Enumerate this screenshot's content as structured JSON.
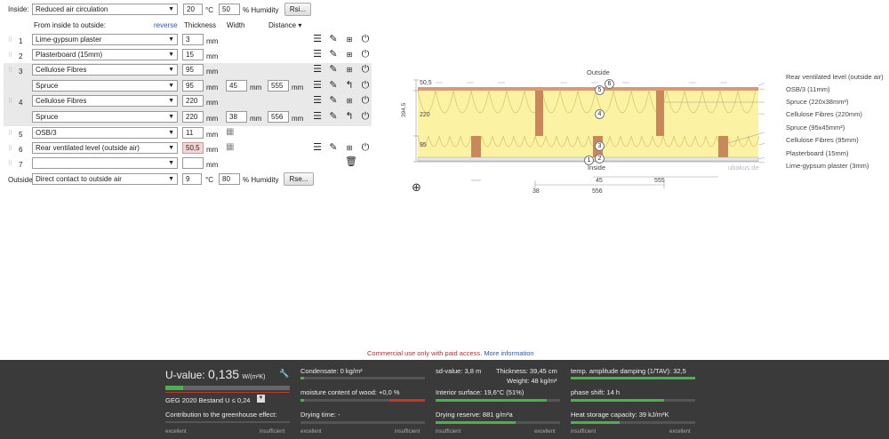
{
  "inside": {
    "label": "Inside:",
    "climate": "Reduced air circulation",
    "temp": "20",
    "temp_unit": "°C",
    "humidity": "50",
    "humidity_unit": "% Humidity",
    "rsi_button": "Rsi..."
  },
  "header": {
    "direction": "From inside to outside:",
    "reverse": "reverse",
    "thickness": "Thickness",
    "width": "Width",
    "distance": "Distance ▾"
  },
  "layers": [
    {
      "num": "1",
      "material": "Lime-gypsum plaster",
      "thickness": "3",
      "unit": "mm"
    },
    {
      "num": "2",
      "material": "Plasterboard (15mm)",
      "thickness": "15",
      "unit": "mm"
    },
    {
      "num": "3",
      "material": "Cellulose Fibres",
      "thickness": "95",
      "unit": "mm",
      "sub_material": "Spruce",
      "sub_thickness": "95",
      "sub_width": "45",
      "sub_distance": "555"
    },
    {
      "num": "4",
      "material": "Cellulose Fibres",
      "thickness": "220",
      "unit": "mm",
      "sub_material": "Spruce",
      "sub_thickness": "220",
      "sub_width": "38",
      "sub_distance": "556"
    },
    {
      "num": "5",
      "material": "OSB/3",
      "thickness": "11",
      "unit": "mm"
    },
    {
      "num": "6",
      "material": "Rear ventilated level (outside air)",
      "thickness": "50,5",
      "unit": "mm"
    },
    {
      "num": "7",
      "material": "",
      "thickness": "",
      "unit": "mm"
    }
  ],
  "outside": {
    "label": "Outside",
    "climate": "Direct contact to outside air",
    "temp": "9",
    "temp_unit": "°C",
    "humidity": "80",
    "humidity_unit": "% Humidity",
    "rse_button": "Rse..."
  },
  "diagram": {
    "outside": "Outside",
    "inside": "Inside",
    "watermark": "ubakus.de",
    "dims": {
      "top": "50,5",
      "middle": "220",
      "lower": "95",
      "total": "394,5",
      "d45": "45",
      "d555": "555",
      "d38": "38",
      "d556": "556"
    },
    "legend": [
      "Rear ventilated level (outside air)",
      "OSB/3 (11mm)",
      "Spruce (220x38mm²)",
      "Cellulose Fibres (220mm)",
      "Spruce (95x45mm²)",
      "Cellulose Fibres (95mm)",
      "Plasterboard (15mm)",
      "Lime-gypsum plaster (3mm)"
    ],
    "markers": [
      "6",
      "5",
      "4",
      "3",
      "2",
      "1"
    ]
  },
  "notice": {
    "text": "Commercial use only with paid access.",
    "link": "More information"
  },
  "footer": {
    "u_label": "U-value:",
    "u_value": "0,135",
    "u_unit": "W/(m²K)",
    "geg": "GEG 2020 Bestand U ≤ 0,24",
    "greenhouse": "Contribution to the greenhouse effect:",
    "condensate": "Condensate: 0 kg/m²",
    "moisture": "moisture content of wood: +0,0 %",
    "drying_time": "Drying time: -",
    "sd": "sd-value: 3,8 m",
    "thickness": "Thickness: 39,45 cm",
    "weight": "Weight: 48 kg/m²",
    "interior": "Interior surface: 19,6°C (51%)",
    "drying_reserve": "Drying reserve: 881 g/m²a",
    "amplitude": "temp. amplitude damping (1/TAV): 32,5",
    "phase": "phase shift: 14 h",
    "heat_storage": "Heat storage capacity: 39 kJ/m²K",
    "excellent": "excellent",
    "insufficient": "insufficient"
  },
  "colors": {
    "insulation": "#fbf3a3",
    "wood": "#c8885a",
    "accent": "#2a5db0",
    "footer_bg": "#3a3a3a"
  }
}
